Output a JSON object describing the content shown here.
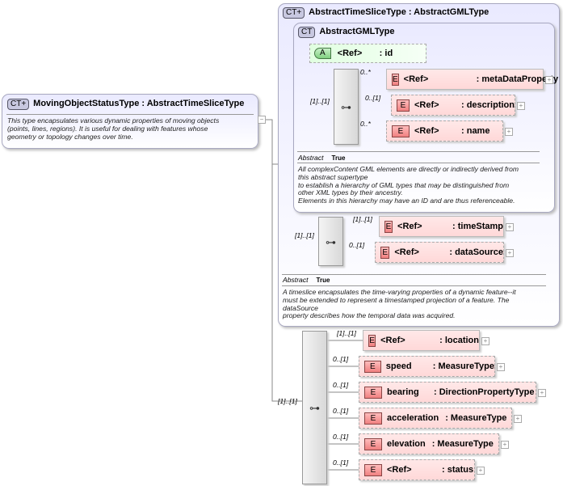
{
  "main": {
    "badge": "CT+",
    "title": "MovingObjectStatusType : AbstractTimeSliceType",
    "collapse": "−",
    "description": [
      "This type encapsulates various dynamic properties of moving objects",
      "(points, lines, regions). It is useful for dealing with features whose",
      "geometry or topology changes over time."
    ]
  },
  "outer": {
    "badge": "CT+",
    "title": "AbstractTimeSliceType : AbstractGMLType",
    "abstract_label": "Abstract",
    "abstract_value": "True",
    "description": [
      "A timeslice encapsulates the time-varying properties of a dynamic feature--it",
      "must be extended to represent a timestamped projection of a feature. The",
      "dataSource",
      "property describes how the temporal data was acquired."
    ],
    "seq_card": "[1]..[1]",
    "elements": [
      {
        "card": "[1]..[1]",
        "name": "<Ref>",
        "type": ": timeStamp"
      },
      {
        "card": "0..[1]",
        "name": "<Ref>",
        "type": ": dataSource"
      }
    ]
  },
  "inner": {
    "badge": "CT",
    "title": "AbstractGMLType",
    "abstract_label": "Abstract",
    "abstract_value": "True",
    "attribute": {
      "badge": "A",
      "name": "<Ref>",
      "type": ": id"
    },
    "seq_card": "[1]..[1]",
    "elements": [
      {
        "card": "0..*",
        "name": "<Ref>",
        "type": ": metaDataProperty"
      },
      {
        "card": "0..[1]",
        "name": "<Ref>",
        "type": ": description"
      },
      {
        "card": "0..*",
        "name": "<Ref>",
        "type": ": name"
      }
    ],
    "description": [
      "All complexContent GML elements are directly or indirectly derived from",
      "this abstract supertype",
      "to establish a hierarchy of GML types that may be distinguished from",
      "other XML types by their ancestry.",
      "Elements in this hierarchy may have an ID and are thus referenceable."
    ]
  },
  "sequence": {
    "card": "[1]..[1]",
    "elements": [
      {
        "card": "[1]..[1]",
        "name": "<Ref>",
        "type": ": location"
      },
      {
        "card": "0..[1]",
        "name": "speed",
        "type": ": MeasureType"
      },
      {
        "card": "0..[1]",
        "name": "bearing",
        "type": ": DirectionPropertyType"
      },
      {
        "card": "0..[1]",
        "name": "acceleration",
        "type": ": MeasureType"
      },
      {
        "card": "0..[1]",
        "name": "elevation",
        "type": ": MeasureType"
      },
      {
        "card": "0..[1]",
        "name": "<Ref>",
        "type": ": status"
      }
    ]
  },
  "labels": {
    "element_badge": "E",
    "expand": "+",
    "seq_icon": "⊶"
  }
}
